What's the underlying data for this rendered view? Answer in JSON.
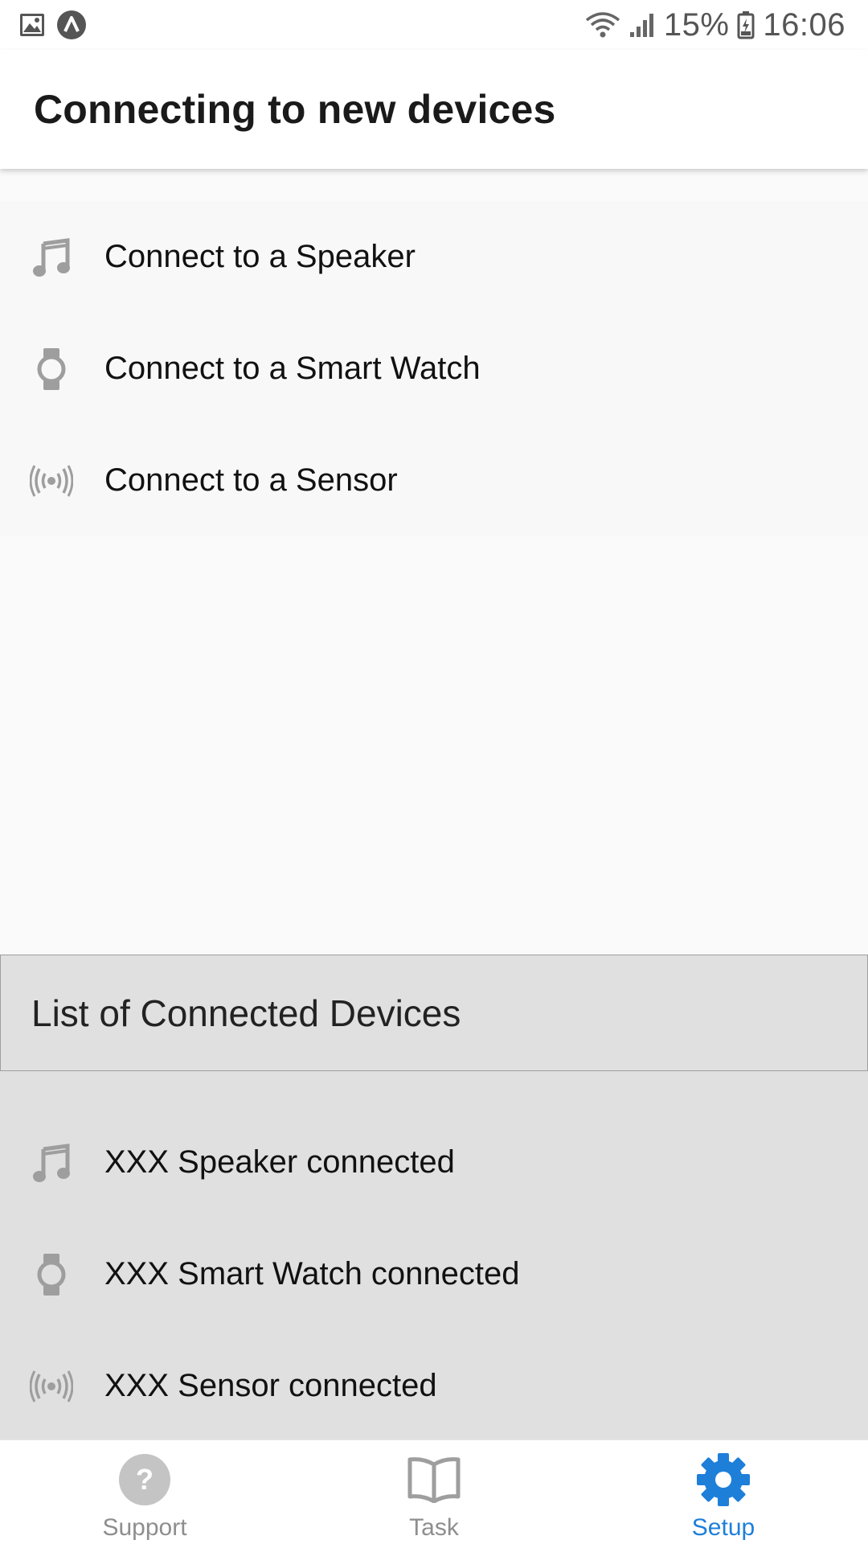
{
  "status_bar": {
    "battery": "15%",
    "time": "16:06",
    "icons": [
      "image-icon",
      "app-notification-icon",
      "wifi-icon",
      "signal-icon",
      "battery-icon"
    ]
  },
  "app_bar": {
    "title": "Connecting to new devices"
  },
  "connect_options": [
    {
      "label": "Connect to a Speaker",
      "icon": "music-note-icon"
    },
    {
      "label": "Connect to a Smart Watch",
      "icon": "watch-icon"
    },
    {
      "label": "Connect to a Sensor",
      "icon": "sensor-icon"
    }
  ],
  "connected_section": {
    "title": "List of Connected Devices",
    "items": [
      {
        "label": "XXX Speaker connected",
        "icon": "music-note-icon"
      },
      {
        "label": "XXX Smart Watch connected",
        "icon": "watch-icon"
      },
      {
        "label": "XXX Sensor connected",
        "icon": "sensor-icon"
      }
    ]
  },
  "bottom_nav": {
    "items": [
      {
        "label": "Support",
        "icon": "help-icon"
      },
      {
        "label": "Task",
        "icon": "book-icon"
      },
      {
        "label": "Setup",
        "icon": "gear-icon"
      }
    ],
    "active": "Setup"
  },
  "colors": {
    "accent": "#1e7fd9",
    "icon_gray": "#9e9e9e",
    "section_bg": "#e0e0e0"
  }
}
